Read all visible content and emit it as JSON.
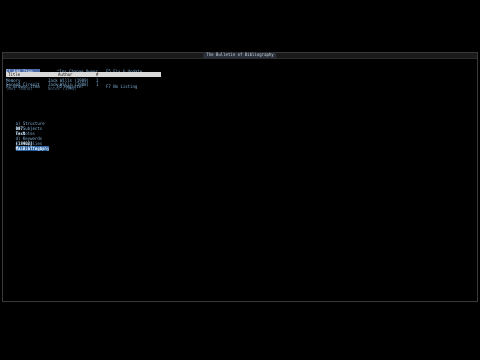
{
  "window": {
    "title": "The Bulletin of Bibliography"
  },
  "menu": {
    "col1": [
      "F1 Add Item",
      "F2 Browse Item"
    ],
    "col2": [
      "^Ins Change Owner",
      "F6 Register"
    ],
    "col3": [
      "F5 Fix & Update",
      "F7 No Listing"
    ]
  },
  "table": {
    "headers": [
      "Title",
      "Author",
      "#"
    ],
    "rows": [
      {
        "title": "Memory",
        "author": "Jack Wills (1989)",
        "count": "1"
      },
      {
        "title": "Second Circuit",
        "author": "Jack Wills (1988)",
        "count": "1"
      },
      {
        "title": "(Not found)",
        "author": "Notes (1990)",
        "count": ""
      }
    ]
  },
  "tabs": {
    "items": [
      "a) Structure",
      "b) Subjects",
      "c) Notes",
      "d) Keywords",
      "e) Supplies",
      "f) Bibliogaphy"
    ],
    "selected": 5
  },
  "trigger": {
    "code": "007",
    "label": "Text",
    "number": "[18402]",
    "value": "Main effects"
  },
  "colors": {
    "background": "#000000",
    "text_blue": "#7fb0d8",
    "header_bg": "#d9d9d9",
    "selected_tab": "#2a5fa0"
  }
}
